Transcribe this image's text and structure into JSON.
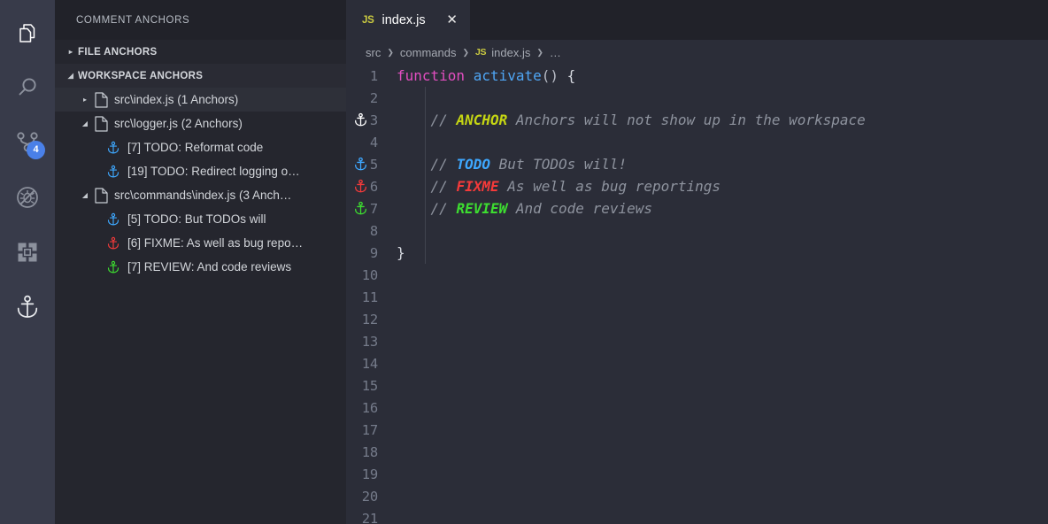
{
  "activity_bar": {
    "items": [
      {
        "name": "explorer",
        "icon": "files-icon",
        "active": true,
        "badge": null
      },
      {
        "name": "search",
        "icon": "search-icon",
        "active": false,
        "badge": null
      },
      {
        "name": "source-control",
        "icon": "source-control-icon",
        "active": false,
        "badge": "4"
      },
      {
        "name": "run-and-debug",
        "icon": "debug-icon",
        "active": false,
        "badge": null
      },
      {
        "name": "extensions",
        "icon": "extensions-icon",
        "active": false,
        "badge": null
      },
      {
        "name": "comment-anchors",
        "icon": "anchor-icon",
        "active": true,
        "badge": null
      }
    ]
  },
  "sidebar": {
    "title": "COMMENT ANCHORS",
    "sections": [
      {
        "label": "FILE ANCHORS",
        "expanded": false,
        "twisty": "▸"
      },
      {
        "label": "WORKSPACE ANCHORS",
        "expanded": true,
        "twisty": "◢"
      }
    ],
    "tree": [
      {
        "kind": "file",
        "label": "src\\index.js (1 Anchors)",
        "expanded": false,
        "twisty": "▸",
        "hover": true
      },
      {
        "kind": "file",
        "label": "src\\logger.js (2 Anchors)",
        "expanded": true,
        "twisty": "◢",
        "hover": false
      },
      {
        "kind": "anchor",
        "label": "[7] TODO: Reformat code",
        "color": "#3ea8ff"
      },
      {
        "kind": "anchor",
        "label": "[19] TODO: Redirect logging o…",
        "color": "#3ea8ff"
      },
      {
        "kind": "file",
        "label": "src\\commands\\index.js (3 Anch…",
        "expanded": true,
        "twisty": "◢",
        "hover": false
      },
      {
        "kind": "anchor",
        "label": "[5] TODO: But TODOs will",
        "color": "#3ea8ff"
      },
      {
        "kind": "anchor",
        "label": "[6] FIXME: As well as bug repo…",
        "color": "#f43a3a"
      },
      {
        "kind": "anchor",
        "label": "[7] REVIEW: And code reviews",
        "color": "#3ddd30"
      }
    ]
  },
  "editor": {
    "tab": {
      "icon_label": "JS",
      "label": "index.js",
      "close_label": "✕"
    },
    "breadcrumbs": [
      {
        "text": "src",
        "type": "folder"
      },
      {
        "text": "commands",
        "type": "folder"
      },
      {
        "text": "index.js",
        "type": "file",
        "icon_label": "JS"
      },
      {
        "text": "…",
        "type": "symbol"
      }
    ],
    "breadcrumb_separator": "❯",
    "line_numbers": [
      "1",
      "2",
      "3",
      "4",
      "5",
      "6",
      "7",
      "8",
      "9",
      "10",
      "11",
      "12",
      "13",
      "14",
      "15",
      "16",
      "17",
      "18",
      "19",
      "20",
      "21"
    ],
    "lines": [
      {
        "n": "1",
        "gutter_anchor": null,
        "tokens": [
          {
            "t": "function",
            "c": "kw"
          },
          {
            "t": " ",
            "c": "pn"
          },
          {
            "t": "activate",
            "c": "fn"
          },
          {
            "t": "()",
            "c": "pn"
          },
          {
            "t": " ",
            "c": "pn"
          },
          {
            "t": "{",
            "c": "brace"
          }
        ]
      },
      {
        "n": "2",
        "gutter_anchor": null,
        "tokens": []
      },
      {
        "n": "3",
        "gutter_anchor": "#ffffff",
        "tokens": [
          {
            "t": "    // ",
            "c": "cmt"
          },
          {
            "t": "ANCHOR",
            "c": "tag-anchor"
          },
          {
            "t": " Anchors will not show up in the workspace",
            "c": "cmt"
          }
        ]
      },
      {
        "n": "4",
        "gutter_anchor": null,
        "tokens": []
      },
      {
        "n": "5",
        "gutter_anchor": "#3ea8ff",
        "tokens": [
          {
            "t": "    // ",
            "c": "cmt"
          },
          {
            "t": "TODO",
            "c": "tag-todo"
          },
          {
            "t": " But TODOs will!",
            "c": "cmt"
          }
        ]
      },
      {
        "n": "6",
        "gutter_anchor": "#f43a3a",
        "tokens": [
          {
            "t": "    // ",
            "c": "cmt"
          },
          {
            "t": "FIXME",
            "c": "tag-fixme"
          },
          {
            "t": " As well as bug reportings",
            "c": "cmt"
          }
        ]
      },
      {
        "n": "7",
        "gutter_anchor": "#3ddd30",
        "tokens": [
          {
            "t": "    // ",
            "c": "cmt"
          },
          {
            "t": "REVIEW",
            "c": "tag-review"
          },
          {
            "t": " And code reviews",
            "c": "cmt"
          }
        ]
      },
      {
        "n": "8",
        "gutter_anchor": null,
        "tokens": []
      },
      {
        "n": "9",
        "gutter_anchor": null,
        "tokens": [
          {
            "t": "}",
            "c": "brace"
          }
        ]
      },
      {
        "n": "10",
        "gutter_anchor": null,
        "tokens": []
      },
      {
        "n": "11",
        "gutter_anchor": null,
        "tokens": []
      },
      {
        "n": "12",
        "gutter_anchor": null,
        "tokens": []
      },
      {
        "n": "13",
        "gutter_anchor": null,
        "tokens": []
      },
      {
        "n": "14",
        "gutter_anchor": null,
        "tokens": []
      },
      {
        "n": "15",
        "gutter_anchor": null,
        "tokens": []
      },
      {
        "n": "16",
        "gutter_anchor": null,
        "tokens": []
      },
      {
        "n": "17",
        "gutter_anchor": null,
        "tokens": []
      },
      {
        "n": "18",
        "gutter_anchor": null,
        "tokens": []
      },
      {
        "n": "19",
        "gutter_anchor": null,
        "tokens": []
      },
      {
        "n": "20",
        "gutter_anchor": null,
        "tokens": []
      },
      {
        "n": "21",
        "gutter_anchor": null,
        "tokens": []
      }
    ]
  },
  "colors": {
    "activity_bar_bg": "#383b4a",
    "sidebar_bg": "#25262e",
    "sidebar_title_bg": "#212229",
    "editor_bg": "#2b2d38",
    "badge_bg": "#4a80e8",
    "todo": "#3ea8ff",
    "fixme": "#f43a3a",
    "review": "#3ddd30",
    "anchor_tag": "#c5d613"
  }
}
